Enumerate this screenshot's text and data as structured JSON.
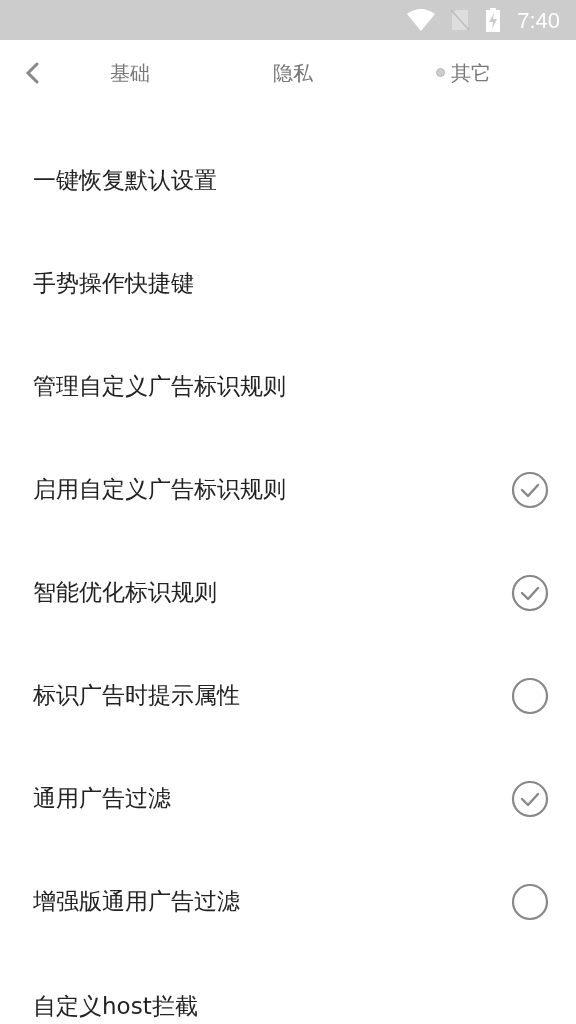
{
  "status_bar": {
    "time": "7:40"
  },
  "tabs": [
    {
      "label": "基础",
      "selected": false
    },
    {
      "label": "隐私",
      "selected": false
    },
    {
      "label": "其它",
      "selected": true
    }
  ],
  "settings": [
    {
      "label": "一键恢复默认设置",
      "kind": "action"
    },
    {
      "label": "手势操作快捷键",
      "kind": "action"
    },
    {
      "label": "管理自定义广告标识规则",
      "kind": "action"
    },
    {
      "label": "启用自定义广告标识规则",
      "kind": "toggle",
      "checked": true
    },
    {
      "label": "智能优化标识规则",
      "kind": "toggle",
      "checked": true
    },
    {
      "label": "标识广告时提示属性",
      "kind": "toggle",
      "checked": false
    },
    {
      "label": "通用广告过滤",
      "kind": "toggle",
      "checked": true
    },
    {
      "label": "增强版通用广告过滤",
      "kind": "toggle",
      "checked": false
    },
    {
      "label": "自定义host拦截",
      "kind": "action"
    }
  ]
}
